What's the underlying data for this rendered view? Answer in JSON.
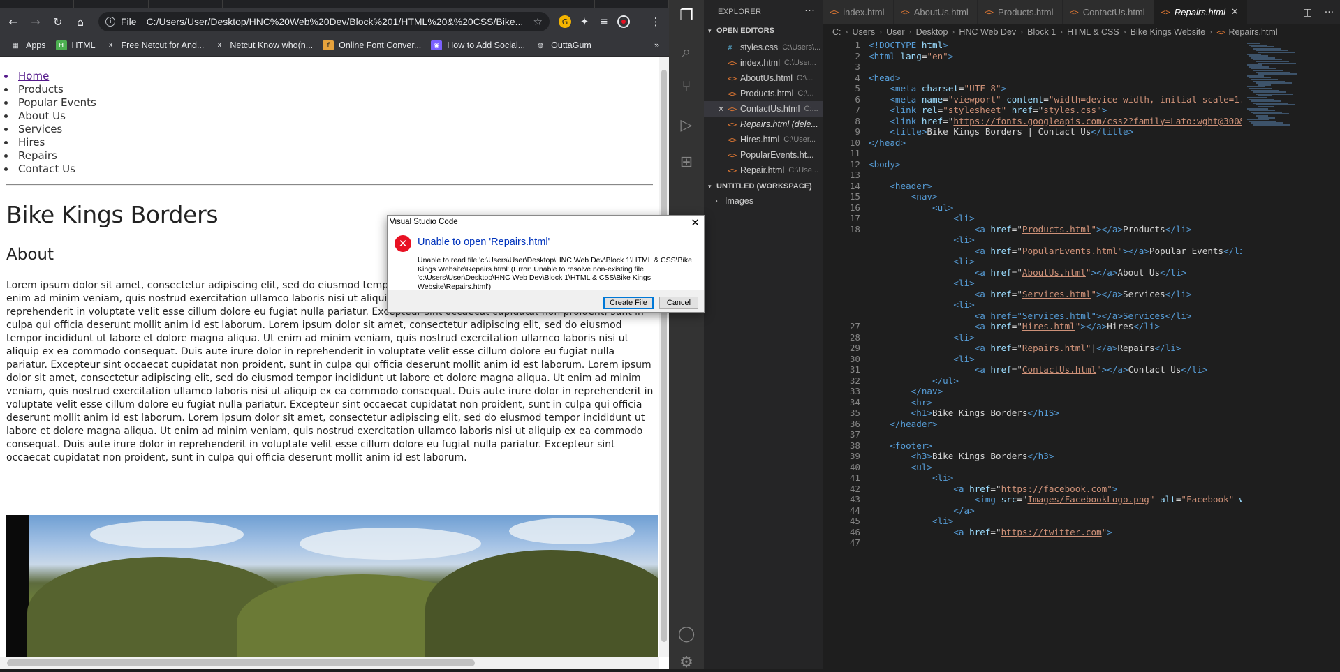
{
  "browser": {
    "address": {
      "scheme": "File",
      "url": "C:/Users/User/Desktop/HNC%20Web%20Dev/Block%201/HTML%20&%20CSS/Bike..."
    },
    "bookmarks": [
      {
        "icon": "apps-icon",
        "label": "Apps"
      },
      {
        "icon": "html-icon",
        "label": "HTML"
      },
      {
        "icon": "netcut-icon",
        "label": "Free Netcut for And..."
      },
      {
        "icon": "netcut-icon",
        "label": "Netcut Know who(n..."
      },
      {
        "icon": "font-icon",
        "label": "Online Font Conver..."
      },
      {
        "icon": "social-icon",
        "label": "How to Add Social..."
      },
      {
        "icon": "outtagum-icon",
        "label": "OuttaGum"
      }
    ],
    "overflow_label": "»"
  },
  "page": {
    "nav": [
      "Home",
      "Products",
      "Popular Events",
      "About Us",
      "Services",
      "Hires",
      "Repairs",
      "Contact Us"
    ],
    "h1": "Bike Kings Borders",
    "h2": "About",
    "lorem": "Lorem ipsum dolor sit amet, consectetur adipiscing elit, sed do eiusmod tempor incididunt ut labore et dolore magna aliqua. Ut enim ad minim veniam, quis nostrud exercitation ullamco laboris nisi ut aliquip ex ea commodo consequat. Duis aute irure dolor in reprehenderit in voluptate velit esse cillum dolore eu fugiat nulla pariatur. Excepteur sint occaecat cupidatat non proident, sunt in culpa qui officia deserunt mollit anim id est laborum. Lorem ipsum dolor sit amet, consectetur adipiscing elit, sed do eiusmod tempor incididunt ut labore et dolore magna aliqua. Ut enim ad minim veniam, quis nostrud exercitation ullamco laboris nisi ut aliquip ex ea commodo consequat. Duis aute irure dolor in reprehenderit in voluptate velit esse cillum dolore eu fugiat nulla pariatur. Excepteur sint occaecat cupidatat non proident, sunt in culpa qui officia deserunt mollit anim id est laborum. Lorem ipsum dolor sit amet, consectetur adipiscing elit, sed do eiusmod tempor incididunt ut labore et dolore magna aliqua. Ut enim ad minim veniam, quis nostrud exercitation ullamco laboris nisi ut aliquip ex ea commodo consequat. Duis aute irure dolor in reprehenderit in voluptate velit esse cillum dolore eu fugiat nulla pariatur. Excepteur sint occaecat cupidatat non proident, sunt in culpa qui officia deserunt mollit anim id est laborum. Lorem ipsum dolor sit amet, consectetur adipiscing elit, sed do eiusmod tempor incididunt ut labore et dolore magna aliqua. Ut enim ad minim veniam, quis nostrud exercitation ullamco laboris nisi ut aliquip ex ea commodo consequat. Duis aute irure dolor in reprehenderit in voluptate velit esse cillum dolore eu fugiat nulla pariatur. Excepteur sint occaecat cupidatat non proident, sunt in culpa qui officia deserunt mollit anim id est laborum."
  },
  "vscode": {
    "explorer_title": "EXPLORER",
    "open_editors_label": "OPEN EDITORS",
    "open_editors": [
      {
        "icon": "css-file-icon",
        "name": "styles.css",
        "path": "C:\\Users\\..."
      },
      {
        "icon": "html-file-icon",
        "name": "index.html",
        "path": "C:\\User..."
      },
      {
        "icon": "html-file-icon",
        "name": "AboutUs.html",
        "path": "C:\\..."
      },
      {
        "icon": "html-file-icon",
        "name": "Products.html",
        "path": "C:\\..."
      },
      {
        "icon": "html-file-icon",
        "name": "ContactUs.html",
        "path": "C:..."
      },
      {
        "icon": "html-file-icon",
        "name": "Repairs.html (dele...",
        "path": ""
      },
      {
        "icon": "html-file-icon",
        "name": "Hires.html",
        "path": "C:\\User..."
      },
      {
        "icon": "html-file-icon",
        "name": "PopularEvents.ht...",
        "path": ""
      },
      {
        "icon": "html-file-icon",
        "name": "Repair.html",
        "path": "C:\\Use..."
      }
    ],
    "workspace_label": "UNTITLED (WORKSPACE)",
    "folder": "Images",
    "tabs": [
      "index.html",
      "AboutUs.html",
      "Products.html",
      "ContactUs.html",
      "Repairs.html"
    ],
    "active_tab": "Repairs.html",
    "breadcrumbs": [
      "C:",
      "Users",
      "User",
      "Desktop",
      "HNC Web Dev",
      "Block 1",
      "HTML & CSS",
      "Bike Kings Website",
      "Repairs.html"
    ],
    "code_lines": [
      "1",
      "2",
      "3",
      "4",
      "5",
      "6",
      "7",
      "8",
      "9",
      "10",
      "11",
      "12",
      "13",
      "14",
      "15",
      "16",
      "17",
      "18",
      "27",
      "28",
      "29",
      "30",
      "31",
      "32",
      "33",
      "34",
      "35",
      "36",
      "37",
      "38",
      "39",
      "40",
      "41",
      "42",
      "43",
      "44",
      "45",
      "46",
      "47"
    ]
  },
  "dialog": {
    "title": "Visual Studio Code",
    "heading": "Unable to open 'Repairs.html'",
    "message": "Unable to read file 'c:\\Users\\User\\Desktop\\HNC Web Dev\\Block 1\\HTML & CSS\\Bike Kings Website\\Repairs.html' (Error: Unable to resolve non-existing file 'c:\\Users\\User\\Desktop\\HNC Web Dev\\Block 1\\HTML & CSS\\Bike Kings Website\\Repairs.html')",
    "primary_button": "Create File",
    "secondary_button": "Cancel"
  }
}
